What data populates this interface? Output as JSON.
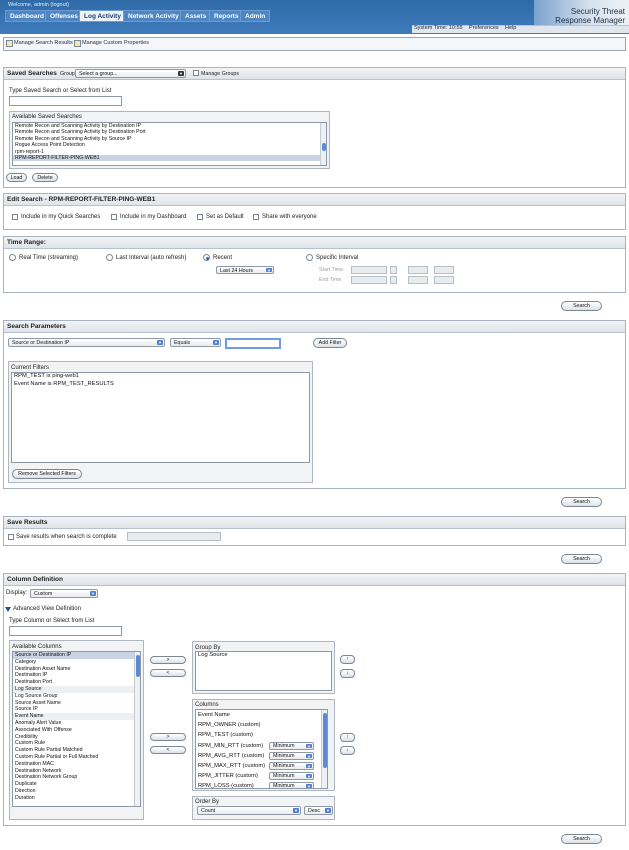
{
  "header": {
    "welcome": "Welcome, admin (logout)",
    "tabs": [
      "Dashboard",
      "Offenses",
      "Log Activity",
      "Network Activity",
      "Assets",
      "Reports",
      "Admin"
    ],
    "active_tab": "Log Activity",
    "brand_line1": "Security Threat",
    "brand_line2": "Response Manager",
    "system_time": "System Time: 10:55",
    "preferences": "Preferences",
    "help": "Help"
  },
  "toolbar": {
    "manage_search_results": "Manage Search Results",
    "manage_custom_properties": "Manage Custom Properties"
  },
  "saved_searches": {
    "title": "Saved Searches",
    "group_label": "Group:",
    "group_value": "Select a group...",
    "manage_groups": "Manage Groups",
    "type_label": "Type Saved Search or Select from List",
    "available_label": "Available Saved Searches",
    "items": [
      "Remote Recon and Scanning Activity by Destination IP",
      "Remote Recon and Scanning Activity by Destination Port",
      "Remote Recon and Scanning Activity by Source IP",
      "Rogue Access Point Detection",
      "rpm-report-1",
      "RPM-REPORT-FILTER-PING-WEB1"
    ],
    "load": "Load",
    "delete": "Delete"
  },
  "edit_search": {
    "title": "Edit Search - RPM-REPORT-FILTER-PING-WEB1",
    "quick": "Include in my Quick Searches",
    "dashboard": "Include in my Dashboard",
    "default": "Set as Default",
    "share": "Share with everyone"
  },
  "time_range": {
    "title": "Time Range:",
    "real_time": "Real Time (streaming)",
    "last_interval": "Last Interval (auto refresh)",
    "recent": "Recent",
    "recent_value": "Last 24 Hours",
    "specific": "Specific Interval",
    "start_time": "Start Time",
    "end_time": "End Time",
    "search": "Search"
  },
  "search_params": {
    "title": "Search Parameters",
    "field": "Source or Destination IP",
    "operator": "Equals",
    "value": "",
    "add_filter": "Add Filter",
    "current_filters": "Current Filters",
    "filters": [
      "RPM_TEST is ping-web1",
      "Event Name is RPM_TEST_RESULTS"
    ],
    "remove": "Remove Selected Filters",
    "search": "Search"
  },
  "save_results": {
    "title": "Save Results",
    "checkbox": "Save results when search is complete",
    "search": "Search"
  },
  "column_def": {
    "title": "Column Definition",
    "display_label": "Display:",
    "display_value": "Custom",
    "advanced": "Advanced View Definition",
    "type_label": "Type Column or Select from List",
    "available_label": "Available Columns",
    "available": [
      "Source or Destination IP",
      "Category",
      "Destination Asset Name",
      "Destination IP",
      "Destination Port",
      "Log Source",
      "Log Source Group",
      "Source Asset Name",
      "Source IP",
      "Event Name",
      "Anomaly Alert Value",
      "Associated With Offense",
      "Credibility",
      "Custom Rule",
      "Custom Rule Partial Matched",
      "Custom Rule Partial or Full Matched",
      "Destination MAC",
      "Destination Network",
      "Destination Network Group",
      "Duplicate",
      "Direction",
      "Duration"
    ],
    "group_by_label": "Group By",
    "group_by": [
      "Log Source"
    ],
    "columns_label": "Columns",
    "columns": [
      {
        "name": "Event Name",
        "agg": ""
      },
      {
        "name": "RPM_OWNER (custom)",
        "agg": ""
      },
      {
        "name": "RPM_TEST (custom)",
        "agg": ""
      },
      {
        "name": "RPM_MIN_RTT (custom)",
        "agg": "Minimum"
      },
      {
        "name": "RPM_AVG_RTT (custom)",
        "agg": "Minimum"
      },
      {
        "name": "RPM_MAX_RTT (custom)",
        "agg": "Minimum"
      },
      {
        "name": "RPM_JITTER (custom)",
        "agg": "Minimum"
      },
      {
        "name": "RPM_LOSS (custom)",
        "agg": "Minimum"
      }
    ],
    "order_by_label": "Order By",
    "order_by": "Count",
    "order_dir": "Desc",
    "search": "Search"
  }
}
